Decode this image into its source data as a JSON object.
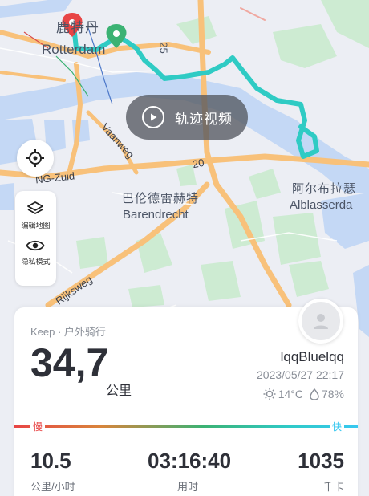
{
  "map": {
    "labels": {
      "rotterdam_zh": "鹿特丹",
      "rotterdam_en": "Rotterdam",
      "barendrecht_zh": "巴伦德雷赫特",
      "barendrecht_en": "Barendrecht",
      "alblasserdam_zh": "阿尔布拉瑟",
      "alblasserdam_en": "Alblasserda",
      "road_vaanweg": "Vaanweg",
      "road_zuid": "NG-Zuid",
      "road_rijksweg": "Rijksweg",
      "road_20": "20",
      "road_25": "25"
    },
    "colors": {
      "water": "#c4d8f5",
      "park": "#cdebd2",
      "road": "#f8c17a",
      "track": "#2fcbc4",
      "start_pin": "#3bb273",
      "end_pin": "#e84545"
    }
  },
  "video_button": {
    "label": "轨迹视频",
    "icon": "play-icon"
  },
  "locate_button": {
    "icon": "crosshair-icon"
  },
  "side_panel": {
    "items": [
      {
        "label": "编辑地图",
        "icon": "layers-icon"
      },
      {
        "label": "隐私模式",
        "icon": "eye-icon"
      }
    ]
  },
  "summary": {
    "source": "Keep · 户外骑行",
    "distance": "34,7",
    "distance_unit": "公里",
    "username": "lqqBluelqq",
    "datetime": "2023/05/27 22:17",
    "temperature": "14°C",
    "humidity": "78%",
    "speed_slow_label": "慢",
    "speed_fast_label": "快",
    "stats": [
      {
        "value": "10.5",
        "label": "公里/小时"
      },
      {
        "value": "03:16:40",
        "label": "用时"
      },
      {
        "value": "1035",
        "label": "千卡"
      }
    ]
  }
}
